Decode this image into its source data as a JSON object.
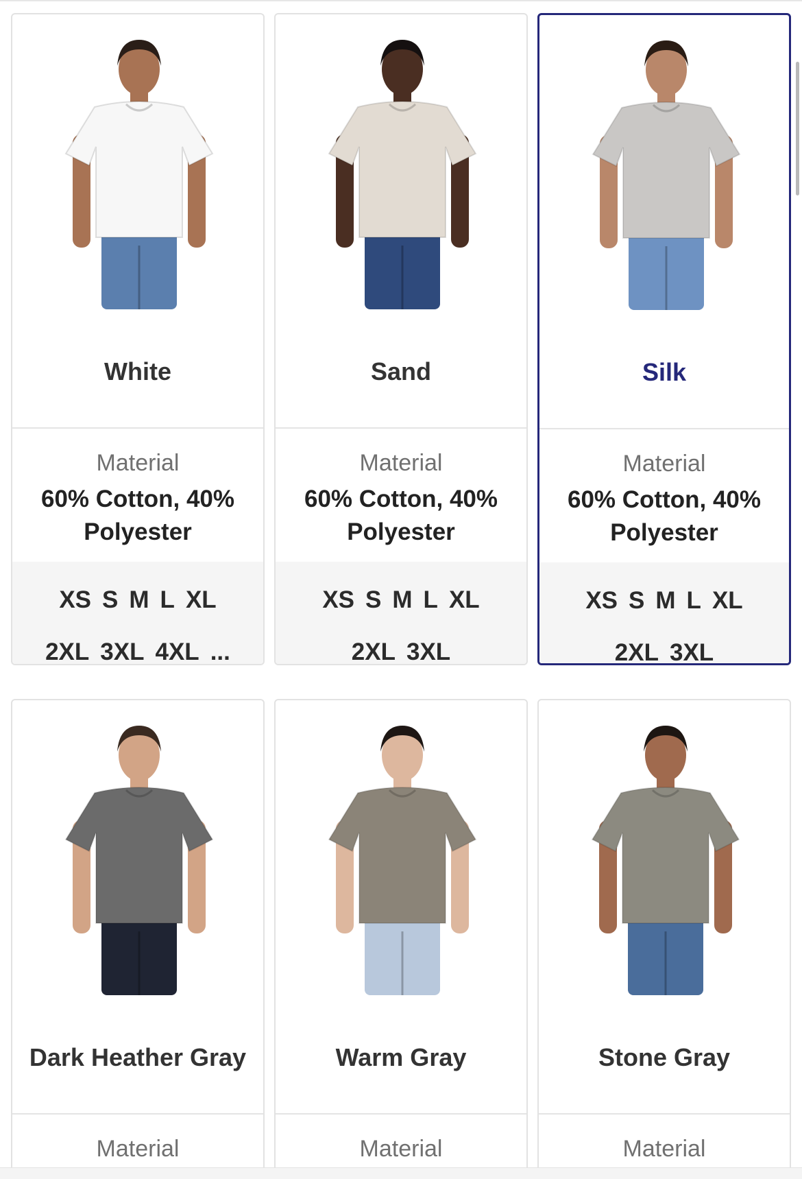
{
  "products": [
    {
      "color_name": "White",
      "material_label": "Material",
      "material": "60% Cotton, 40% Polyester",
      "sizes_row1": [
        "XS",
        "S",
        "M",
        "L",
        "XL"
      ],
      "sizes_row2": [
        "2XL",
        "3XL",
        "4XL",
        "..."
      ],
      "shirt_color": "#f7f7f7",
      "pants_color": "#5b7fae",
      "skin_color": "#a87354",
      "hair_color": "#2a1e18",
      "selected": false
    },
    {
      "color_name": "Sand",
      "material_label": "Material",
      "material": "60% Cotton, 40% Polyester",
      "sizes_row1": [
        "XS",
        "S",
        "M",
        "L",
        "XL"
      ],
      "sizes_row2": [
        "2XL",
        "3XL"
      ],
      "shirt_color": "#e2dbd2",
      "pants_color": "#2f4a7c",
      "skin_color": "#4a2e22",
      "hair_color": "#151010",
      "selected": false
    },
    {
      "color_name": "Silk",
      "material_label": "Material",
      "material": "60% Cotton, 40% Polyester",
      "sizes_row1": [
        "XS",
        "S",
        "M",
        "L",
        "XL"
      ],
      "sizes_row2": [
        "2XL",
        "3XL"
      ],
      "shirt_color": "#c9c7c5",
      "pants_color": "#6e92c2",
      "skin_color": "#b9876a",
      "hair_color": "#2a1c14",
      "selected": true
    },
    {
      "color_name": "Dark Heather Gray",
      "material_label": "Material",
      "material": "",
      "sizes_row1": [],
      "sizes_row2": [],
      "shirt_color": "#6b6b6b",
      "pants_color": "#1f2433",
      "skin_color": "#d2a486",
      "hair_color": "#3a2a20",
      "selected": false
    },
    {
      "color_name": "Warm Gray",
      "material_label": "Material",
      "material": "",
      "sizes_row1": [],
      "sizes_row2": [],
      "shirt_color": "#8b8478",
      "pants_color": "#b8c8dc",
      "skin_color": "#ddb79e",
      "hair_color": "#1e1714",
      "selected": false
    },
    {
      "color_name": "Stone Gray",
      "material_label": "Material",
      "material": "",
      "sizes_row1": [],
      "sizes_row2": [],
      "shirt_color": "#8c8a80",
      "pants_color": "#4a6d9b",
      "skin_color": "#a06a4e",
      "hair_color": "#1d1612",
      "selected": false
    }
  ]
}
